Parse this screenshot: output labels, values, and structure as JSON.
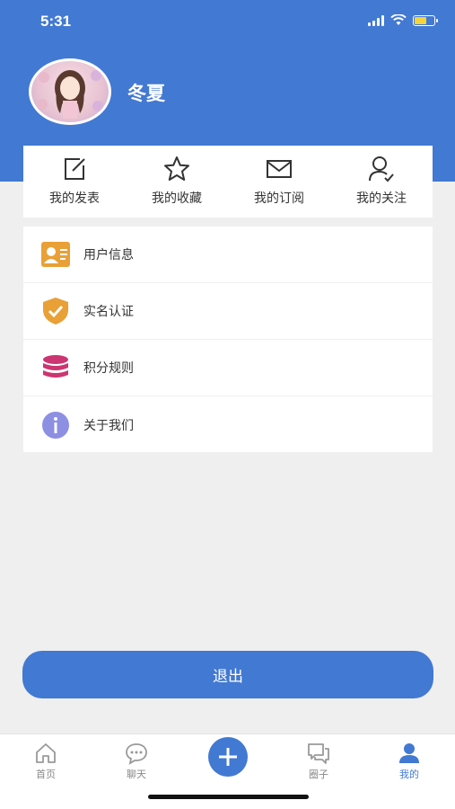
{
  "status_bar": {
    "time": "5:31"
  },
  "profile": {
    "username": "冬夏"
  },
  "quick_actions": [
    {
      "label": "我的发表",
      "icon": "edit-icon"
    },
    {
      "label": "我的收藏",
      "icon": "star-icon"
    },
    {
      "label": "我的订阅",
      "icon": "mail-icon"
    },
    {
      "label": "我的关注",
      "icon": "user-check-icon"
    }
  ],
  "menu": [
    {
      "label": "用户信息",
      "icon": "id-card-icon"
    },
    {
      "label": "实名认证",
      "icon": "shield-check-icon"
    },
    {
      "label": "积分规则",
      "icon": "coins-icon"
    },
    {
      "label": "关于我们",
      "icon": "info-icon"
    }
  ],
  "logout_label": "退出",
  "tabs": [
    {
      "label": "首页",
      "icon": "home-icon"
    },
    {
      "label": "聊天",
      "icon": "chat-icon"
    },
    {
      "label": "圈子",
      "icon": "comments-icon"
    },
    {
      "label": "我的",
      "icon": "person-icon",
      "active": true
    }
  ],
  "colors": {
    "primary": "#4279d2",
    "background": "#efefef"
  }
}
